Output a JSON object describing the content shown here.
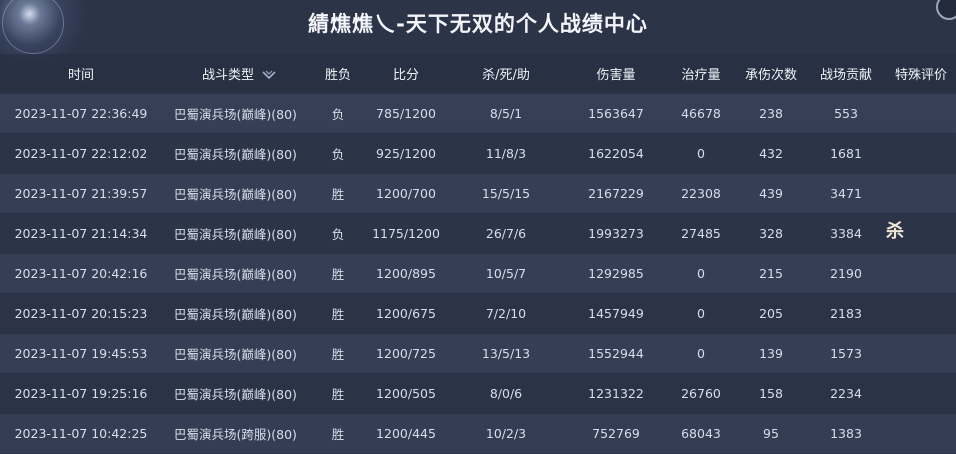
{
  "title": "綪燋燋乀-天下无双的个人战绩中心",
  "columns": {
    "time": "时间",
    "type": "战斗类型",
    "result": "胜负",
    "score": "比分",
    "kda": "杀/死/助",
    "damage": "伤害量",
    "heal": "治疗量",
    "taken": "承伤次数",
    "contribution": "战场贡献",
    "evaluation": "特殊评价"
  },
  "badge_text": "杀",
  "rows": [
    {
      "time": "2023-11-07 22:36:49",
      "type": "巴蜀演兵场(巅峰)(80)",
      "result": "负",
      "score": "785/1200",
      "kda": "8/5/1",
      "damage": "1563647",
      "heal": "46678",
      "taken": "238",
      "contribution": "553"
    },
    {
      "time": "2023-11-07 22:12:02",
      "type": "巴蜀演兵场(巅峰)(80)",
      "result": "负",
      "score": "925/1200",
      "kda": "11/8/3",
      "damage": "1622054",
      "heal": "0",
      "taken": "432",
      "contribution": "1681"
    },
    {
      "time": "2023-11-07 21:39:57",
      "type": "巴蜀演兵场(巅峰)(80)",
      "result": "胜",
      "score": "1200/700",
      "kda": "15/5/15",
      "damage": "2167229",
      "heal": "22308",
      "taken": "439",
      "contribution": "3471"
    },
    {
      "time": "2023-11-07 21:14:34",
      "type": "巴蜀演兵场(巅峰)(80)",
      "result": "负",
      "score": "1175/1200",
      "kda": "26/7/6",
      "damage": "1993273",
      "heal": "27485",
      "taken": "328",
      "contribution": "3384"
    },
    {
      "time": "2023-11-07 20:42:16",
      "type": "巴蜀演兵场(巅峰)(80)",
      "result": "胜",
      "score": "1200/895",
      "kda": "10/5/7",
      "damage": "1292985",
      "heal": "0",
      "taken": "215",
      "contribution": "2190"
    },
    {
      "time": "2023-11-07 20:15:23",
      "type": "巴蜀演兵场(巅峰)(80)",
      "result": "胜",
      "score": "1200/675",
      "kda": "7/2/10",
      "damage": "1457949",
      "heal": "0",
      "taken": "205",
      "contribution": "2183"
    },
    {
      "time": "2023-11-07 19:45:53",
      "type": "巴蜀演兵场(巅峰)(80)",
      "result": "胜",
      "score": "1200/725",
      "kda": "13/5/13",
      "damage": "1552944",
      "heal": "0",
      "taken": "139",
      "contribution": "1573"
    },
    {
      "time": "2023-11-07 19:25:16",
      "type": "巴蜀演兵场(巅峰)(80)",
      "result": "胜",
      "score": "1200/505",
      "kda": "8/0/6",
      "damage": "1231322",
      "heal": "26760",
      "taken": "158",
      "contribution": "2234"
    },
    {
      "time": "2023-11-07 10:42:25",
      "type": "巴蜀演兵场(跨服)(80)",
      "result": "胜",
      "score": "1200/445",
      "kda": "10/2/3",
      "damage": "752769",
      "heal": "68043",
      "taken": "95",
      "contribution": "1383"
    }
  ]
}
